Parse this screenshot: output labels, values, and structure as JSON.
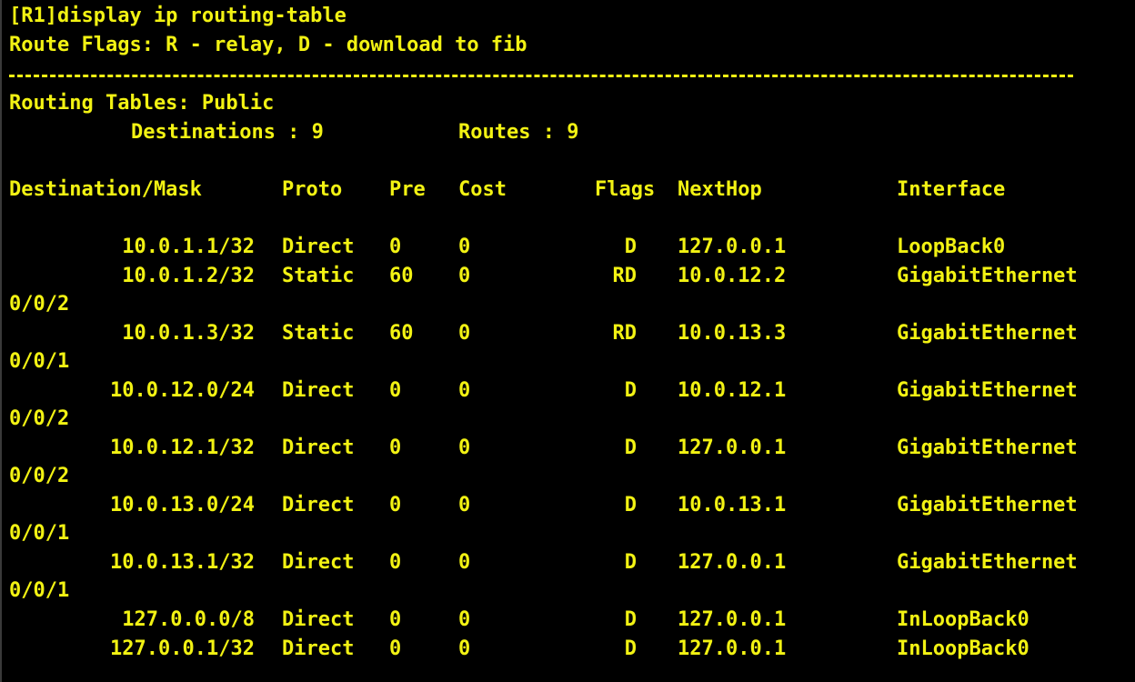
{
  "command_line": "[R1]display ip routing-table",
  "flags_legend": "Route Flags: R - relay, D - download to fib",
  "routing_tables_label": "Routing Tables: Public",
  "summary": {
    "destinations": "Destinations : 9",
    "routes": "Routes : 9"
  },
  "columns": {
    "destination": "Destination/Mask",
    "proto": "Proto",
    "pre": "Pre",
    "cost": "Cost",
    "flags": "Flags",
    "nexthop": "NextHop",
    "interface": "Interface"
  },
  "routes": [
    {
      "dest": "10.0.1.1/32",
      "proto": "Direct",
      "pre": "0",
      "cost": "0",
      "flags": "D",
      "nexthop": "127.0.0.1",
      "iface": "LoopBack0",
      "iface_cont": ""
    },
    {
      "dest": "10.0.1.2/32",
      "proto": "Static",
      "pre": "60",
      "cost": "0",
      "flags": "RD",
      "nexthop": "10.0.12.2",
      "iface": "GigabitEthernet",
      "iface_cont": "0/0/2"
    },
    {
      "dest": "10.0.1.3/32",
      "proto": "Static",
      "pre": "60",
      "cost": "0",
      "flags": "RD",
      "nexthop": "10.0.13.3",
      "iface": "GigabitEthernet",
      "iface_cont": "0/0/1"
    },
    {
      "dest": "10.0.12.0/24",
      "proto": "Direct",
      "pre": "0",
      "cost": "0",
      "flags": "D",
      "nexthop": "10.0.12.1",
      "iface": "GigabitEthernet",
      "iface_cont": "0/0/2"
    },
    {
      "dest": "10.0.12.1/32",
      "proto": "Direct",
      "pre": "0",
      "cost": "0",
      "flags": "D",
      "nexthop": "127.0.0.1",
      "iface": "GigabitEthernet",
      "iface_cont": "0/0/2"
    },
    {
      "dest": "10.0.13.0/24",
      "proto": "Direct",
      "pre": "0",
      "cost": "0",
      "flags": "D",
      "nexthop": "10.0.13.1",
      "iface": "GigabitEthernet",
      "iface_cont": "0/0/1"
    },
    {
      "dest": "10.0.13.1/32",
      "proto": "Direct",
      "pre": "0",
      "cost": "0",
      "flags": "D",
      "nexthop": "127.0.0.1",
      "iface": "GigabitEthernet",
      "iface_cont": "0/0/1"
    },
    {
      "dest": "127.0.0.0/8",
      "proto": "Direct",
      "pre": "0",
      "cost": "0",
      "flags": "D",
      "nexthop": "127.0.0.1",
      "iface": "InLoopBack0",
      "iface_cont": ""
    },
    {
      "dest": "127.0.0.1/32",
      "proto": "Direct",
      "pre": "0",
      "cost": "0",
      "flags": "D",
      "nexthop": "127.0.0.1",
      "iface": "InLoopBack0",
      "iface_cont": ""
    }
  ],
  "colors": {
    "background": "#000000",
    "text": "#f2f213"
  }
}
